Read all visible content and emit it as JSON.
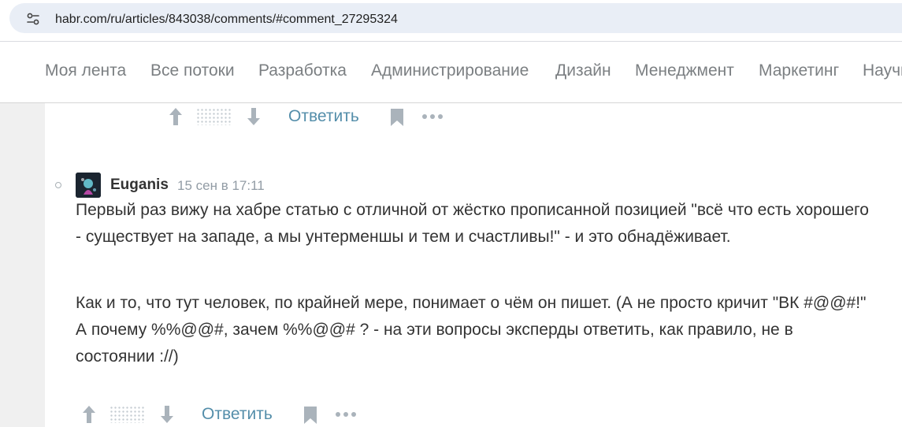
{
  "browser": {
    "url": "habr.com/ru/articles/843038/comments/#comment_27295324"
  },
  "nav": {
    "items": [
      {
        "label": "Моя лента"
      },
      {
        "label": "Все потоки"
      },
      {
        "label": "Разработка"
      },
      {
        "label": "Администрирование"
      },
      {
        "label": "Дизайн"
      },
      {
        "label": "Менеджмент"
      },
      {
        "label": "Маркетинг"
      },
      {
        "label": "Научпоп"
      }
    ]
  },
  "prev_comment": {
    "reply_label": "Ответить"
  },
  "comment": {
    "username": "Euganis",
    "time": "15 сен в 17:11",
    "paragraphs": [
      "Первый раз вижу на хабре статью с отличной от жёстко прописанной позицией \"всё что есть хорошего - существует на западе, а мы унтерменшы и тем и счастливы!\" - и это обнадёживает.",
      "Как и то, что тут человек, по крайней мере, понимает о чём он пишет. (А не просто кричит \"ВК #@@#!\" А почему %%@@#, зачем %%@@# ? - на эти вопросы эксперды ответить, как правило, не в состоянии ://)"
    ],
    "reply_label": "Ответить"
  },
  "icons": {
    "upvote": "arrow-up-icon",
    "downvote": "arrow-down-icon",
    "bookmark": "bookmark-icon",
    "more": "more-dots-icon",
    "site_info": "site-settings-icon"
  },
  "colors": {
    "link": "#548eaa",
    "icon": "#aab3bb",
    "text": "#333333",
    "muted": "#929ca5"
  }
}
